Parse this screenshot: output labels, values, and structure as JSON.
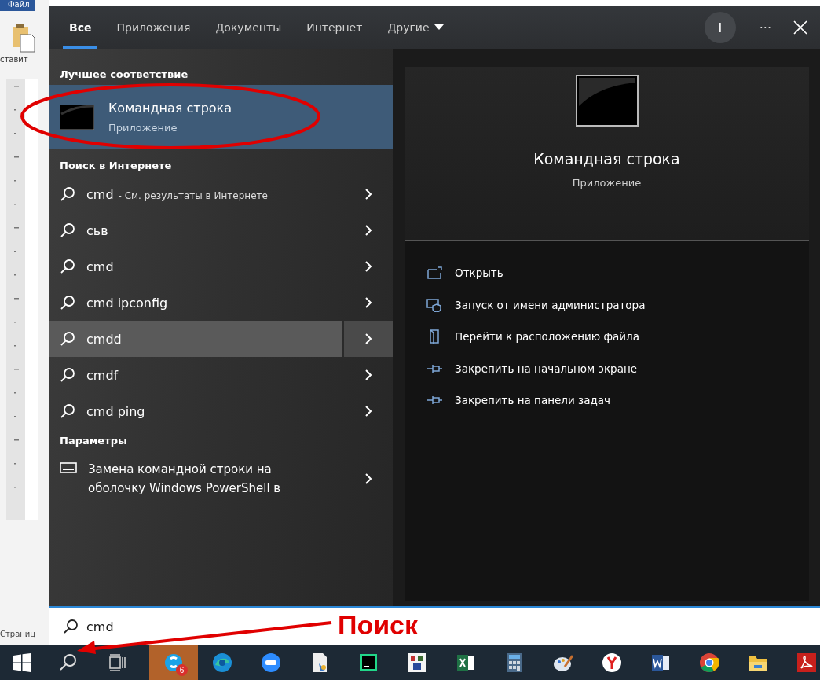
{
  "word_background": {
    "menu_tab": "Файл",
    "paste_label": "ставит",
    "status_text": "Страниц"
  },
  "tabs": [
    {
      "label": "Все",
      "selected": true,
      "kind": "plain"
    },
    {
      "label": "Приложения",
      "selected": false,
      "kind": "plain"
    },
    {
      "label": "Документы",
      "selected": false,
      "kind": "plain"
    },
    {
      "label": "Интернет",
      "selected": false,
      "kind": "plain"
    },
    {
      "label": "Другие",
      "selected": false,
      "kind": "dropdown"
    }
  ],
  "header": {
    "account_initial": "I",
    "more": "···"
  },
  "best_match": {
    "heading": "Лучшее соответствие",
    "title": "Командная строка",
    "subtitle": "Приложение",
    "selected": true
  },
  "web_search": {
    "heading": "Поиск в Интернете",
    "items": [
      {
        "query": "cmd",
        "hint": "- См. результаты в Интернете",
        "selected": false
      },
      {
        "query": "сьв",
        "selected": false
      },
      {
        "query": "cmd",
        "selected": false
      },
      {
        "query": "cmd ipconfig",
        "selected": false
      },
      {
        "query": "cmdd",
        "selected": true
      },
      {
        "query": "cmdf",
        "selected": false
      },
      {
        "query": "cmd ping",
        "selected": false
      }
    ]
  },
  "settings": {
    "heading": "Параметры",
    "items": [
      {
        "label": "Замена командной строки на оболочку Windows PowerShell в"
      }
    ]
  },
  "preview": {
    "title": "Командная строка",
    "subtitle": "Приложение",
    "actions": [
      {
        "label": "Открыть",
        "kind": "open"
      },
      {
        "label": "Запуск от имени администратора",
        "kind": "admin"
      },
      {
        "label": "Перейти к расположению файла",
        "kind": "folder"
      },
      {
        "label": "Закрепить на начальном экране",
        "kind": "pin"
      },
      {
        "label": "Закрепить на панели задач",
        "kind": "pin"
      }
    ]
  },
  "search_box": {
    "value": "cmd"
  },
  "annotation": {
    "label": "Поиск"
  },
  "taskbar": {
    "apps": [
      {
        "kind": "chat",
        "badge": "6",
        "selected": true
      },
      {
        "kind": "edge",
        "selected": false
      },
      {
        "kind": "video",
        "selected": false
      },
      {
        "kind": "document",
        "selected": false
      },
      {
        "kind": "ide",
        "selected": false
      },
      {
        "kind": "spelling",
        "selected": false
      },
      {
        "kind": "excel",
        "selected": false
      },
      {
        "kind": "calculator",
        "selected": false
      },
      {
        "kind": "paint",
        "selected": false
      },
      {
        "kind": "yandex",
        "selected": false
      },
      {
        "kind": "word",
        "selected": false
      },
      {
        "kind": "chrome",
        "selected": false
      },
      {
        "kind": "folder",
        "selected": false
      },
      {
        "kind": "pdf",
        "selected": false
      }
    ]
  }
}
